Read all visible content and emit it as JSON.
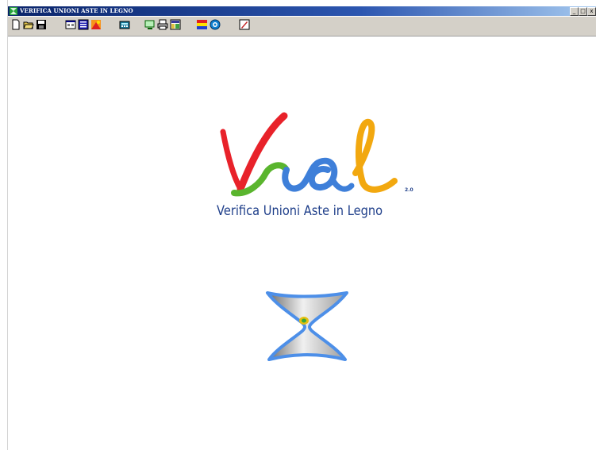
{
  "window": {
    "title": "VERIFICA UNIONI ASTE IN LEGNO",
    "minimize_glyph": "_",
    "maximize_glyph": "□",
    "close_glyph": "x"
  },
  "toolbar": {
    "buttons": [
      {
        "icon": "new-document-icon"
      },
      {
        "icon": "open-folder-icon"
      },
      {
        "icon": "save-disk-icon"
      },
      {
        "icon": "properties-icon"
      },
      {
        "icon": "list-icon"
      },
      {
        "icon": "chart-icon"
      },
      {
        "icon": "calculator-icon"
      },
      {
        "icon": "preview-icon"
      },
      {
        "icon": "print-icon"
      },
      {
        "icon": "report-icon"
      },
      {
        "icon": "text-tool-icon"
      },
      {
        "icon": "target-icon"
      },
      {
        "icon": "edit-icon"
      }
    ]
  },
  "logo": {
    "wordmark": "Vual",
    "subtitle": "Verifica Unioni Aste in Legno",
    "version": "2.0"
  },
  "colors": {
    "titlebar": "#0a246a",
    "toolbar_bg": "#d4d0c8",
    "logo_red": "#e8222a",
    "logo_green": "#5ab52e",
    "logo_blue": "#3e7fd9",
    "logo_orange": "#f2a80f",
    "subtitle_text": "#1f3f8a"
  }
}
